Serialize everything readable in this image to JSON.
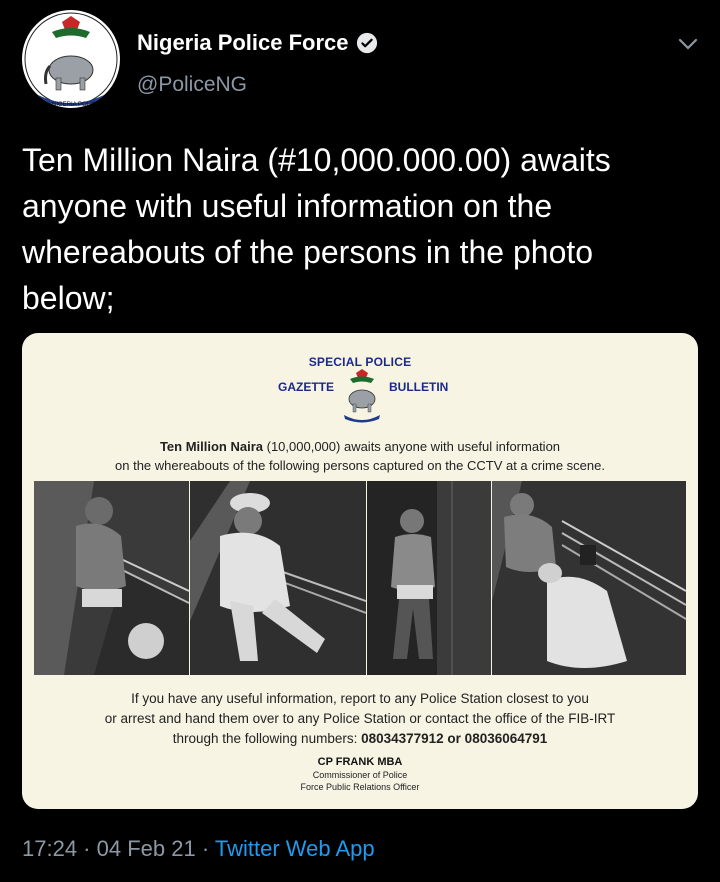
{
  "author": {
    "display_name": "Nigeria Police Force",
    "handle": "@PoliceNG",
    "verified": true,
    "avatar_text": "NIGERIA POLICE"
  },
  "tweet": {
    "text": "Ten Million Naira (#10,000.000.00) awaits anyone with useful information on the whereabouts of the persons in the photo below;"
  },
  "media": {
    "header_line1": "SPECIAL POLICE",
    "header_left": "GAZETTE",
    "header_right": "BULLETIN",
    "lead_bold": "Ten Million Naira",
    "lead_rest": " (10,000,000) awaits anyone with useful information",
    "lead_line2": "on the whereabouts of the following persons captured on the CCTV at a crime scene.",
    "footer_line1": "If you have any useful information, report to any Police Station closest to you",
    "footer_line2": "or arrest and hand them over to any Police Station or contact the office of the FIB-IRT",
    "footer_line3_prefix": "through the following numbers: ",
    "footer_numbers": "08034377912 or 08036064791",
    "signatory_name": "CP FRANK MBA",
    "signatory_title1": "Commissioner of Police",
    "signatory_title2": "Force Public Relations Officer"
  },
  "meta": {
    "time": "17:24",
    "sep1": " · ",
    "date": "04 Feb 21",
    "sep2": " · ",
    "source": "Twitter Web App"
  },
  "icons": {
    "verified": "verified-badge-icon",
    "more": "chevron-down-icon",
    "avatar": "police-crest-logo"
  },
  "colors": {
    "background": "#000000",
    "secondary_text": "#8b98a5",
    "link": "#1d9bf0",
    "gazette_blue": "#1b2a8a",
    "poster_bg": "#f7f4e4"
  }
}
